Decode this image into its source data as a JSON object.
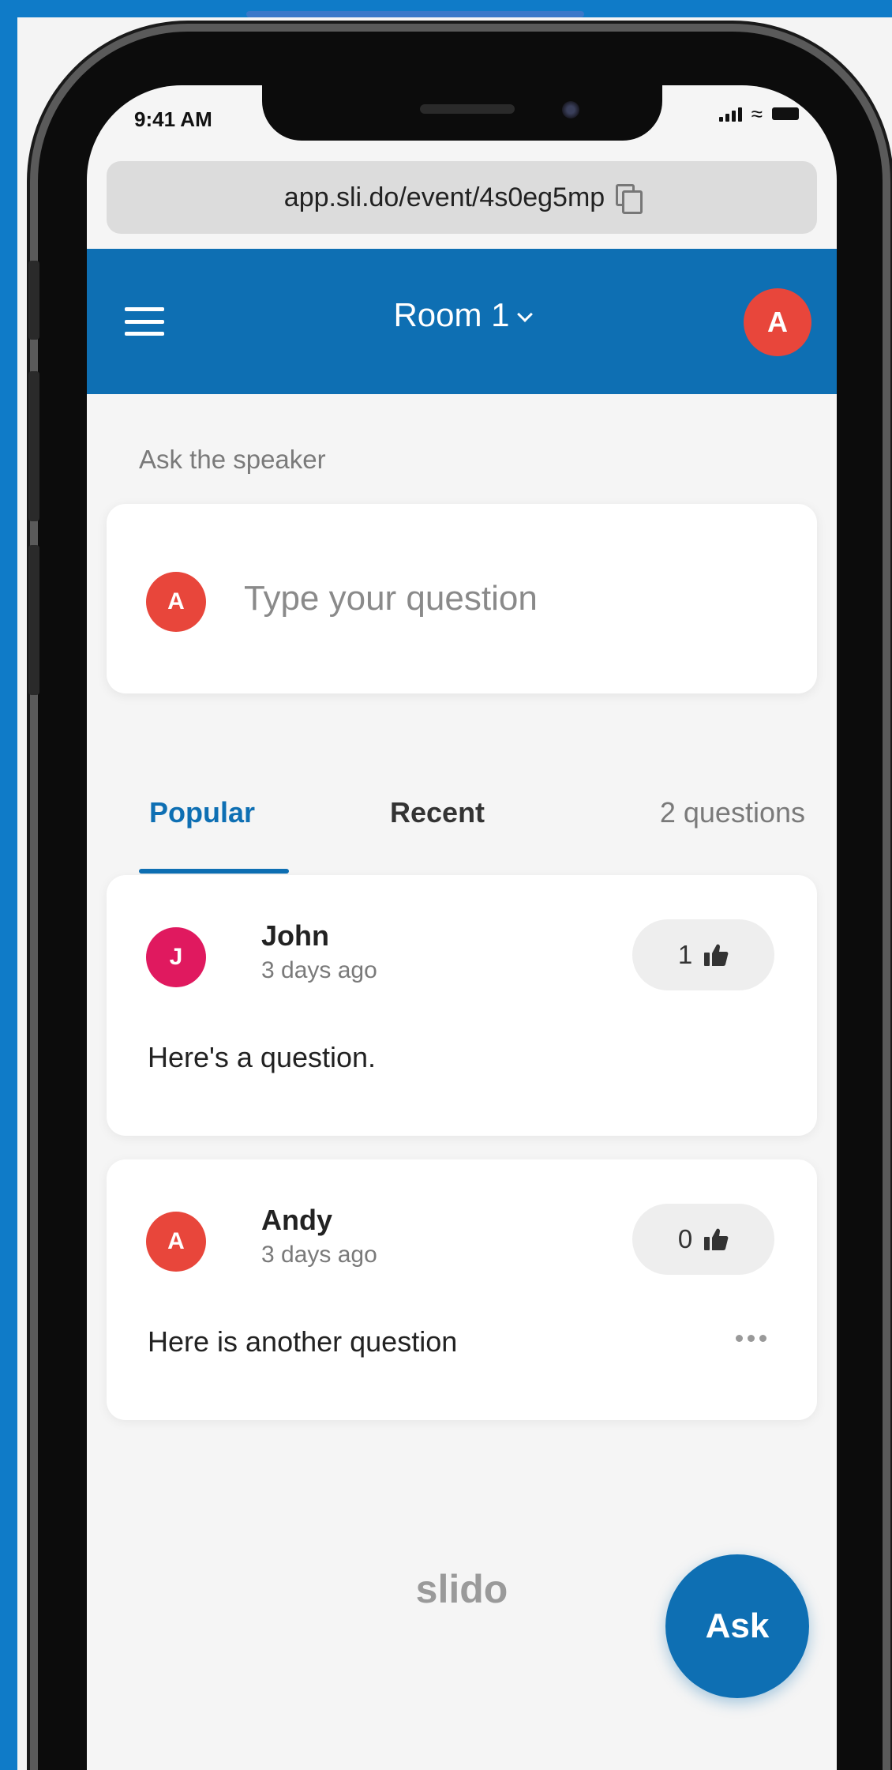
{
  "status_bar": {
    "time": "9:41 AM"
  },
  "browser": {
    "url": "app.sli.do/event/4s0eg5mp"
  },
  "header": {
    "room_title": "Room 1",
    "user_initial": "A"
  },
  "ask_section": {
    "label": "Ask the speaker",
    "user_initial": "A",
    "input_placeholder": "Type your question"
  },
  "tabs": {
    "items": [
      {
        "label": "Popular",
        "active": true
      },
      {
        "label": "Recent",
        "active": false
      }
    ],
    "question_count": "2 questions"
  },
  "questions": [
    {
      "author": "John",
      "initial": "J",
      "avatar_color": "#e0195f",
      "time": "3 days ago",
      "likes": "1",
      "text": "Here's a question."
    },
    {
      "author": "Andy",
      "initial": "A",
      "avatar_color": "#e8463b",
      "time": "3 days ago",
      "likes": "0",
      "text": "Here is another question"
    }
  ],
  "footer": {
    "brand": "slido",
    "ask_button": "Ask"
  },
  "colors": {
    "brand_blue": "#0e6fb3",
    "avatar_red": "#e8463b",
    "avatar_pink": "#e0195f",
    "page_background": "#0f7bc8"
  }
}
